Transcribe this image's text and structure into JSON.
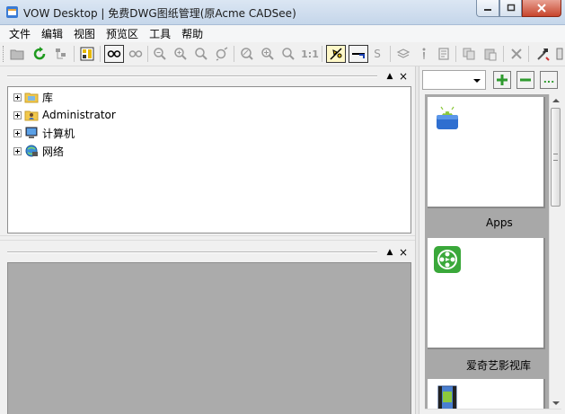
{
  "window": {
    "title": "VOW Desktop | 免费DWG图纸管理(原Acme CADSee)"
  },
  "menu": {
    "items": [
      "文件",
      "编辑",
      "视图",
      "预览区",
      "工具",
      "帮助"
    ]
  },
  "toolbar": {
    "icons": [
      "folder-icon",
      "refresh-icon",
      "tree-icon",
      "layout-icon",
      "view-mode-1-icon",
      "view-mode-2-icon",
      "zoom-out-icon",
      "zoom-in-icon",
      "zoom-window-icon",
      "zoom-extent-icon",
      "zoom-realtime-icon",
      "zoom-prev-icon",
      "zoom-next-icon",
      "actual-size-icon",
      "pan-icon",
      "measure-icon",
      "text-s-icon",
      "layers-icon",
      "info-icon",
      "properties-icon",
      "copy-icon",
      "paste-icon",
      "delete-icon",
      "tools-icon"
    ],
    "actual_size_label": "1:1",
    "text_s_label": "S"
  },
  "tree": {
    "items": [
      {
        "label": "库",
        "icon": "library-folder-icon"
      },
      {
        "label": "Administrator",
        "icon": "user-folder-icon"
      },
      {
        "label": "计算机",
        "icon": "computer-icon"
      },
      {
        "label": "网络",
        "icon": "network-icon"
      }
    ]
  },
  "panel_buttons": {
    "pin": "▲",
    "close": "×"
  },
  "right_panel": {
    "combo_value": "",
    "buttons": [
      "add",
      "remove",
      "more"
    ],
    "more_label": "..."
  },
  "gallery": {
    "items": [
      {
        "label": "Apps",
        "icon": "android-apps-icon"
      },
      {
        "label": "爱奇艺影视库",
        "icon": "film-reel-icon"
      },
      {
        "label": "",
        "icon": "video-file-icon"
      }
    ]
  },
  "colors": {
    "accent_green": "#2e9a2e",
    "preview_bg": "#ababab",
    "gallery_bg": "#a8a8a8"
  }
}
